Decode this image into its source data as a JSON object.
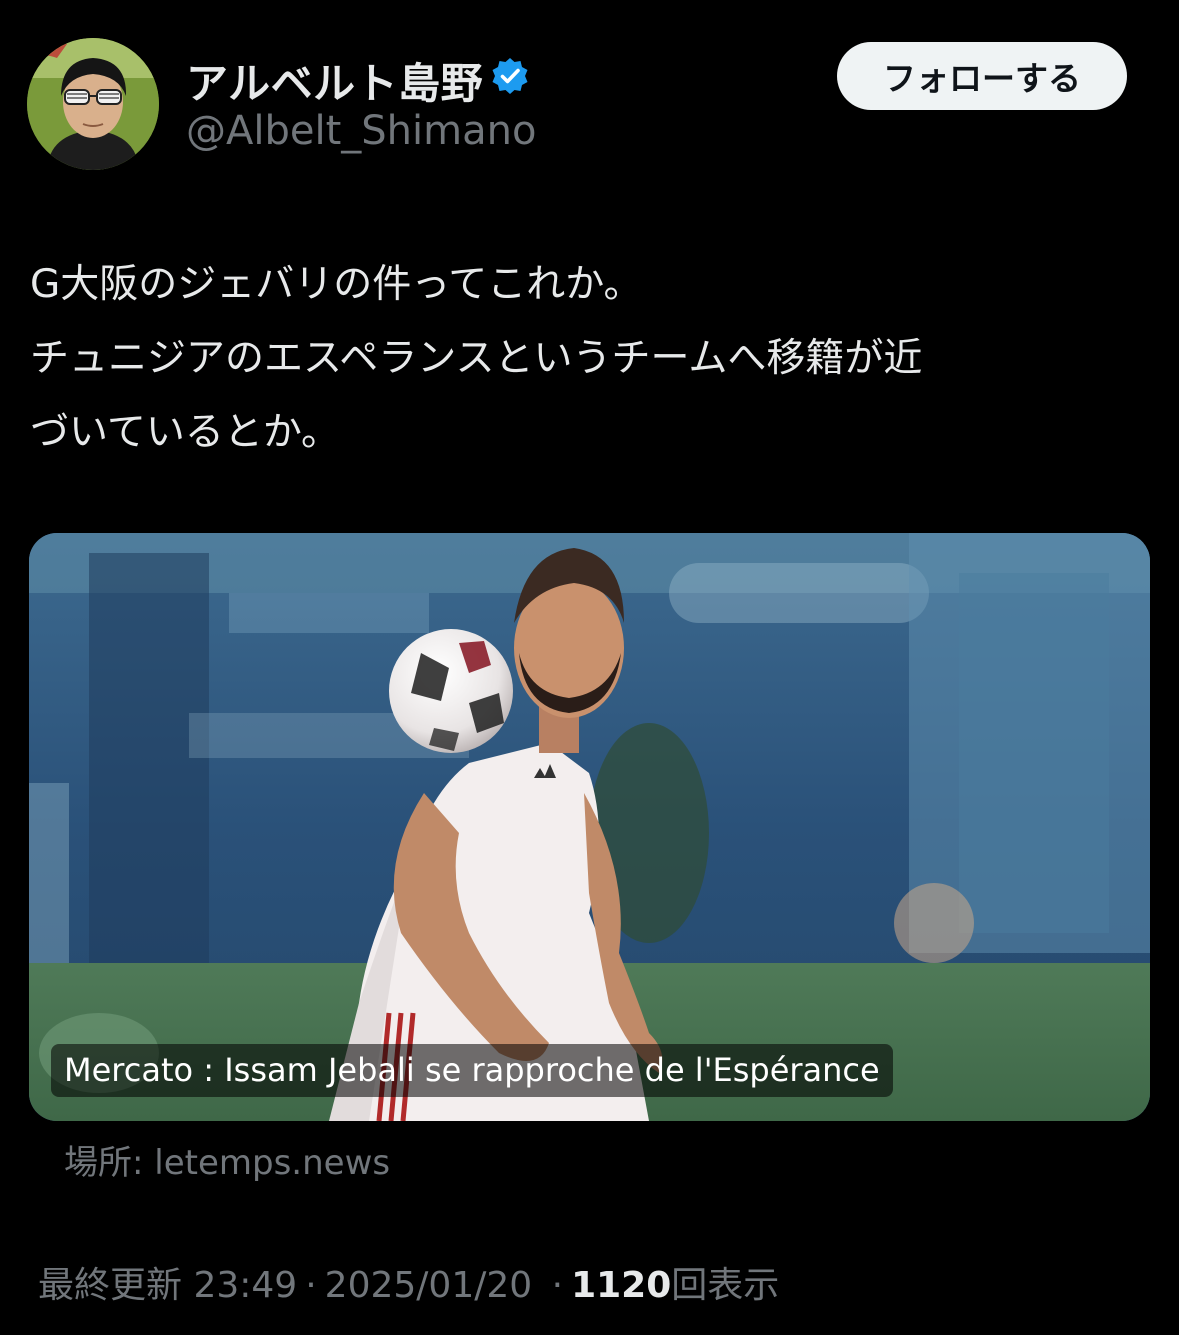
{
  "author": {
    "display_name": "アルベルト島野",
    "handle": "@Albelt_Shimano",
    "verified": true,
    "verified_color": "#1d9bf0"
  },
  "follow_button": {
    "label": "フォローする"
  },
  "tweet": {
    "lines": [
      "G大阪のジェバリの件ってこれか。",
      "チュニジアのエスペランスというチームへ移籍が近",
      "づいているとか。"
    ]
  },
  "link_card": {
    "title": "Mercato : Issam Jebali se rapproche de l'Espérance",
    "source": "場所: letemps.news"
  },
  "meta": {
    "updated_label": "最終更新",
    "time": "23:49",
    "date": "2025/01/20",
    "separator": "·",
    "views_count": "1120",
    "views_label": "回表示"
  },
  "colors": {
    "background": "#000000",
    "text_primary": "#e7e9ea",
    "text_secondary": "#71767b",
    "follow_bg": "#eff3f4"
  },
  "icons": {
    "verified": "verified-badge-icon"
  }
}
